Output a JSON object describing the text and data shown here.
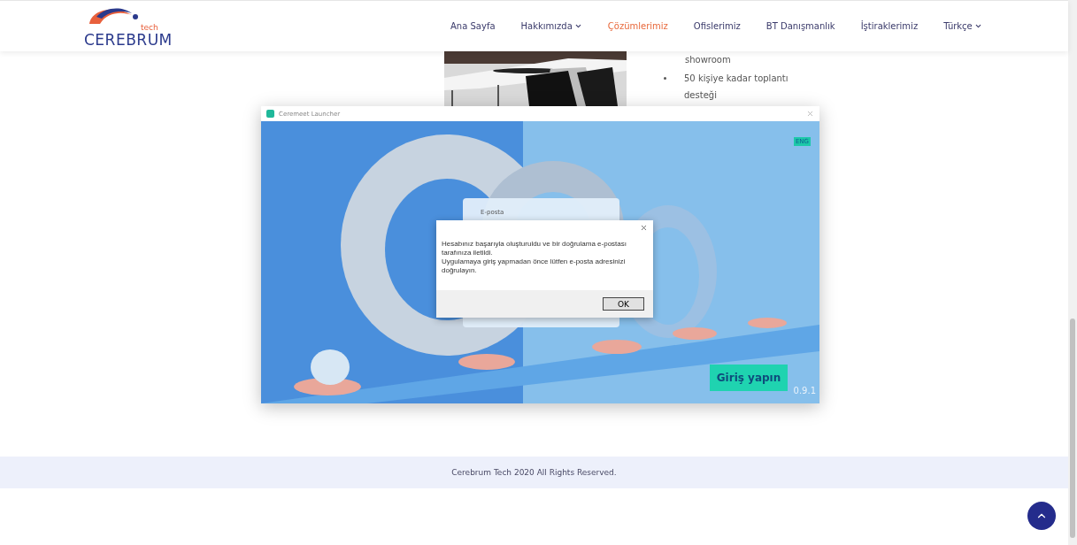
{
  "header": {
    "logo": {
      "small": "tech",
      "name": "CEREBRUM"
    },
    "nav": [
      {
        "label": "Ana Sayfa",
        "selected": false,
        "dropdown": false
      },
      {
        "label": "Hakkımızda",
        "selected": false,
        "dropdown": true
      },
      {
        "label": "Çözümlerimiz",
        "selected": true,
        "dropdown": false
      },
      {
        "label": "Ofislerimiz",
        "selected": false,
        "dropdown": false
      },
      {
        "label": "BT Danışmanlık",
        "selected": false,
        "dropdown": false
      },
      {
        "label": "İştiraklerimiz",
        "selected": false,
        "dropdown": false
      },
      {
        "label": "Türkçe",
        "selected": false,
        "dropdown": true
      }
    ]
  },
  "content": {
    "photo": {
      "kind": "picture"
    },
    "bullet_tail": "showroom",
    "bullets": [
      "50 kişiye kadar toplantı desteği"
    ]
  },
  "launcher": {
    "title": "Ceremeet Launcher",
    "language": "ENG",
    "login_card": {
      "email_label": "E-posta"
    },
    "dialog": {
      "message_lines": [
        "Hesabınız başarıyla oluşturuldu ve bir doğrulama e-postası tarafınıza iletildi.",
        "Uygulamaya giriş yapmadan önce lütfen e-posta adresinizi doğrulayın."
      ],
      "button": "OK"
    },
    "login_button": "Giriş yapın",
    "version": "0.9.1"
  },
  "footer": {
    "text": "Cerebrum Tech 2020 All Rights Reserved."
  }
}
